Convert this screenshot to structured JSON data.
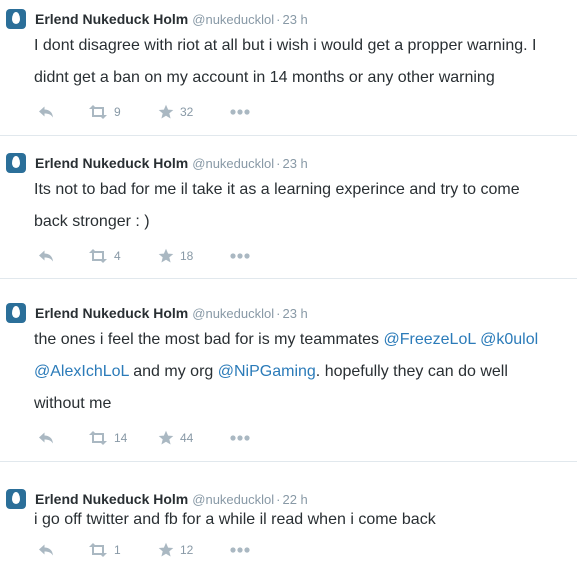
{
  "colors": {
    "icon": "#aab8c2",
    "link": "#2b7bb9",
    "muted": "#8899a6",
    "avatar_bg": "#2b6f99"
  },
  "tweets": [
    {
      "name": "Erlend Nukeduck Holm",
      "handle": "@nukeducklol",
      "time": "23 h",
      "lines": [
        [
          {
            "t": "I dont disagree with riot at all but i wish i would get a propper warning. I",
            "m": false
          }
        ],
        [
          {
            "t": "didnt get a ban on my account in 14 months or any other warning",
            "m": false
          }
        ]
      ],
      "retweets": "9",
      "favorites": "32"
    },
    {
      "name": "Erlend Nukeduck Holm",
      "handle": "@nukeducklol",
      "time": "23 h",
      "lines": [
        [
          {
            "t": "Its not to bad for me il take it as a learning experince and try to come",
            "m": false
          }
        ],
        [
          {
            "t": "back stronger : )",
            "m": false
          }
        ]
      ],
      "retweets": "4",
      "favorites": "18"
    },
    {
      "name": "Erlend Nukeduck Holm",
      "handle": "@nukeducklol",
      "time": "23 h",
      "lines": [
        [
          {
            "t": "the ones i feel the most bad for is my teammates ",
            "m": false
          },
          {
            "t": "@FreezeLoL",
            "m": true
          },
          {
            "t": " ",
            "m": false
          },
          {
            "t": "@k0ulol",
            "m": true
          }
        ],
        [
          {
            "t": "@AlexIchLoL",
            "m": true
          },
          {
            "t": " and my org ",
            "m": false
          },
          {
            "t": "@NiPGaming",
            "m": true
          },
          {
            "t": ". hopefully they can do well",
            "m": false
          }
        ],
        [
          {
            "t": "without me",
            "m": false
          }
        ]
      ],
      "retweets": "14",
      "favorites": "44"
    },
    {
      "name": "Erlend Nukeduck Holm",
      "handle": "@nukeducklol",
      "time": "22 h",
      "lines": [
        [
          {
            "t": "i go off twitter and fb for a while il read when i come back",
            "m": false
          }
        ]
      ],
      "retweets": "1",
      "favorites": "12"
    }
  ],
  "icons": {
    "reply": "reply-icon",
    "retweet": "retweet-icon",
    "favorite": "star-icon",
    "more": "more-icon"
  }
}
